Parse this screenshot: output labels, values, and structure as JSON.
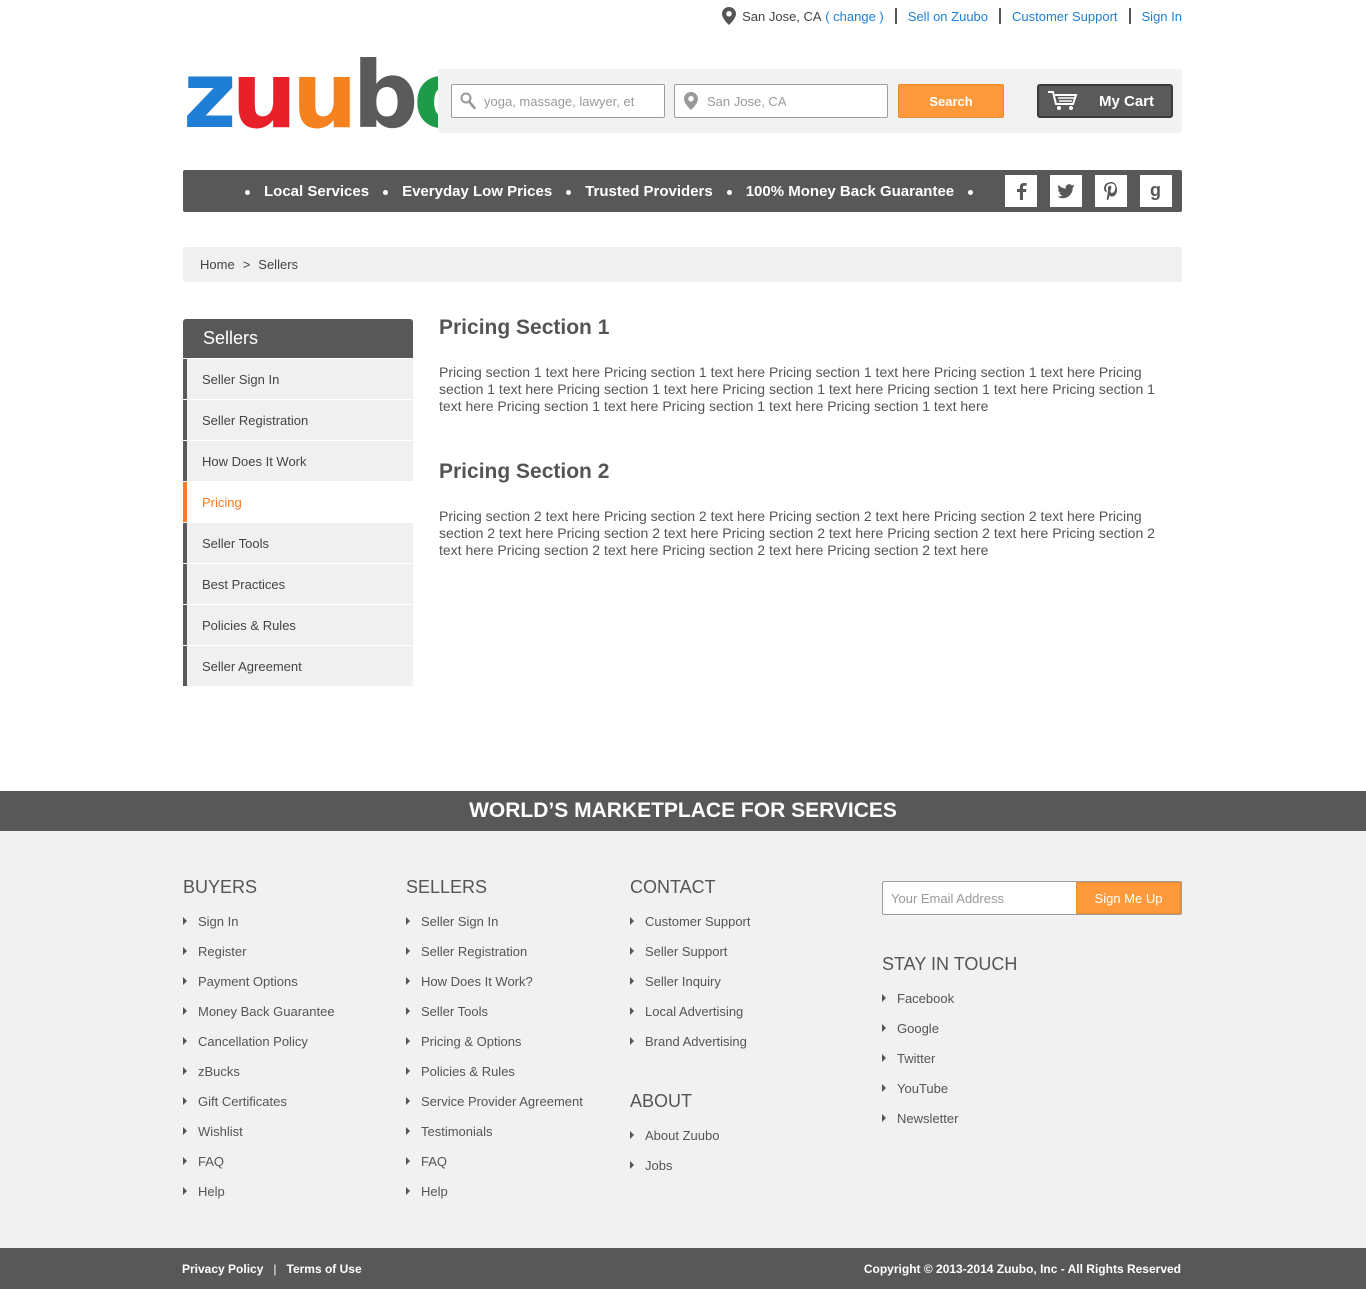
{
  "topbar": {
    "location": "San Jose, CA",
    "change": "( change )",
    "sell": "Sell on Zuubo",
    "support": "Customer Support",
    "signin": "Sign In"
  },
  "logo": {
    "letters": [
      "z",
      "u",
      "u",
      "b",
      "o"
    ],
    "colors": [
      "#1e7fd4",
      "#e8202a",
      "#f5821f",
      "#5a5a5a",
      "#1f9a48"
    ]
  },
  "search": {
    "what_placeholder": "yoga, massage, lawyer, etc",
    "where_placeholder": "San Jose, CA",
    "button": "Search",
    "cart": "My Cart"
  },
  "nav": {
    "items": [
      "Local Services",
      "Everyday Low Prices",
      "Trusted Providers",
      "100% Money Back Guarantee"
    ],
    "social": [
      "f",
      "t",
      "p",
      "g"
    ]
  },
  "breadcrumb": {
    "home": "Home",
    "sep": ">",
    "current": "Sellers"
  },
  "sidebar": {
    "title": "Sellers",
    "items": [
      "Seller Sign In",
      "Seller Registration",
      "How Does It Work",
      "Pricing",
      "Seller Tools",
      "Best Practices",
      "Policies & Rules",
      "Seller Agreement"
    ],
    "active": "Pricing"
  },
  "content": {
    "sections": [
      {
        "title": "Pricing Section 1",
        "text": "Pricing section 1 text here Pricing section 1 text here Pricing section 1 text here Pricing section 1 text here Pricing section 1 text here Pricing section 1 text here Pricing section 1 text here Pricing section 1 text here Pricing section 1 text here Pricing section 1 text here Pricing section 1 text here Pricing section 1 text here"
      },
      {
        "title": "Pricing Section 2",
        "text": "Pricing section 2 text here Pricing section 2 text here Pricing section 2 text here Pricing section 2 text here Pricing section 2 text here Pricing section 2 text here Pricing section 2 text here Pricing section 2 text here Pricing section 2 text here Pricing section 2 text here Pricing section 2 text here Pricing section 2 text here"
      }
    ]
  },
  "footer": {
    "band": "WORLD’S MARKETPLACE FOR SERVICES",
    "buyers": {
      "title": "BUYERS",
      "items": [
        "Sign In",
        "Register",
        "Payment Options",
        "Money Back Guarantee",
        "Cancellation Policy",
        "zBucks",
        "Gift Certificates",
        "Wishlist",
        "FAQ",
        "Help"
      ]
    },
    "sellers": {
      "title": "SELLERS",
      "items": [
        "Seller Sign In",
        "Seller Registration",
        "How Does It Work?",
        "Seller Tools",
        "Pricing & Options",
        "Policies & Rules",
        "Service Provider Agreement",
        "Testimonials",
        "FAQ",
        "Help"
      ]
    },
    "contact": {
      "title": "CONTACT",
      "items": [
        "Customer Support",
        "Seller Support",
        "Seller Inquiry",
        "Local Advertising",
        "Brand Advertising"
      ]
    },
    "about": {
      "title": "ABOUT",
      "items": [
        "About Zuubo",
        "Jobs"
      ]
    },
    "newsletter": {
      "placeholder": "Your Email Address",
      "button": "Sign Me Up"
    },
    "stay": {
      "title": "STAY IN TOUCH",
      "items": [
        "Facebook",
        "Google",
        "Twitter",
        "YouTube",
        "Newsletter"
      ]
    }
  },
  "bottom": {
    "privacy": "Privacy Policy",
    "sep": "|",
    "terms": "Terms of Use",
    "copyright": "Copyright © 2013-2014 Zuubo, Inc - All Rights Reserved"
  },
  "colors": {
    "accent": "#ff9a3c",
    "active": "#ff7a1a",
    "link": "#1e7fd4",
    "dark": "#585858"
  }
}
